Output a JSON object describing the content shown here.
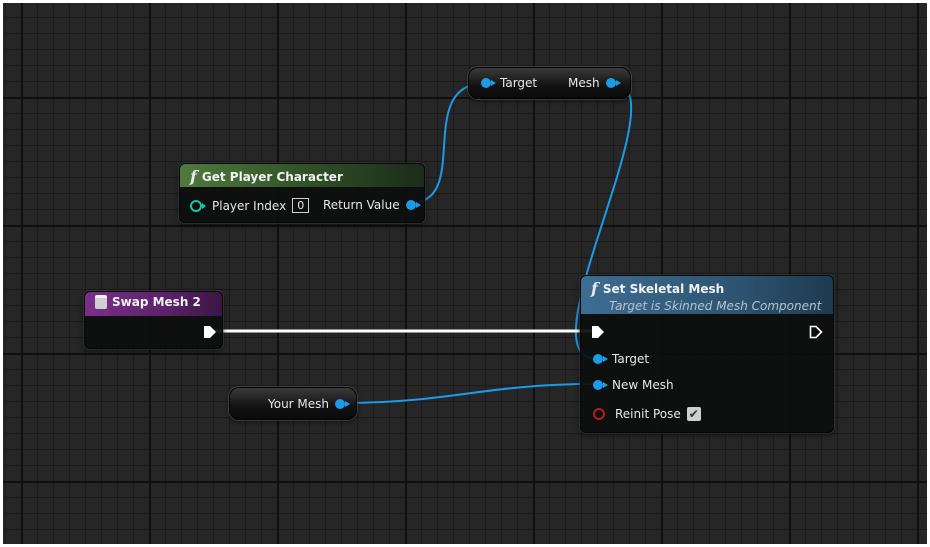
{
  "nodes": {
    "get_player_character": {
      "title": "Get Player Character",
      "player_index_label": "Player Index",
      "player_index_value": "0",
      "return_value_label": "Return Value"
    },
    "mesh_getter": {
      "target_label": "Target",
      "mesh_label": "Mesh"
    },
    "swap_mesh": {
      "title": "Swap Mesh 2"
    },
    "set_skeletal_mesh": {
      "title": "Set Skeletal Mesh",
      "subtitle": "Target is Skinned Mesh Component",
      "target_label": "Target",
      "new_mesh_label": "New Mesh",
      "reinit_pose_label": "Reinit Pose",
      "reinit_pose_checked": true
    },
    "your_mesh": {
      "label": "Your Mesh"
    }
  },
  "colors": {
    "function_header": "#4f7a3e",
    "event_header": "#7a2f8a",
    "target_header": "#3d6d92",
    "object_pin": "#1a9ce8",
    "bool_pin": "#b01e1e",
    "int_pin": "#19c3a6",
    "exec_wire": "#ffffff"
  },
  "icons": {
    "function": "function-f-icon",
    "event": "event-icon",
    "checkbox": "checkmark-icon"
  }
}
